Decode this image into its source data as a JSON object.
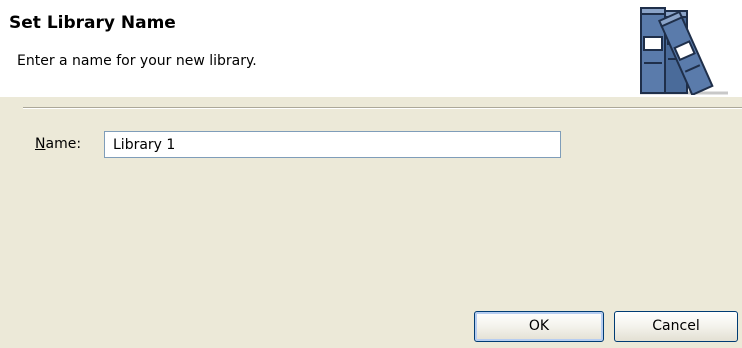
{
  "dialog": {
    "title": "Set Library Name",
    "description": "Enter a name for your new library.",
    "banner_icon": "library-books-icon"
  },
  "form": {
    "name_label_mnemonic": "N",
    "name_label_rest": "ame:",
    "name_value": "Library 1"
  },
  "buttons": {
    "ok_label": "OK",
    "cancel_label": "Cancel"
  },
  "colors": {
    "dialog_background": "#ece9d8",
    "header_background": "#ffffff",
    "input_border": "#7f9db9",
    "button_border": "#003c74",
    "book_blue": "#4a6b9a"
  }
}
